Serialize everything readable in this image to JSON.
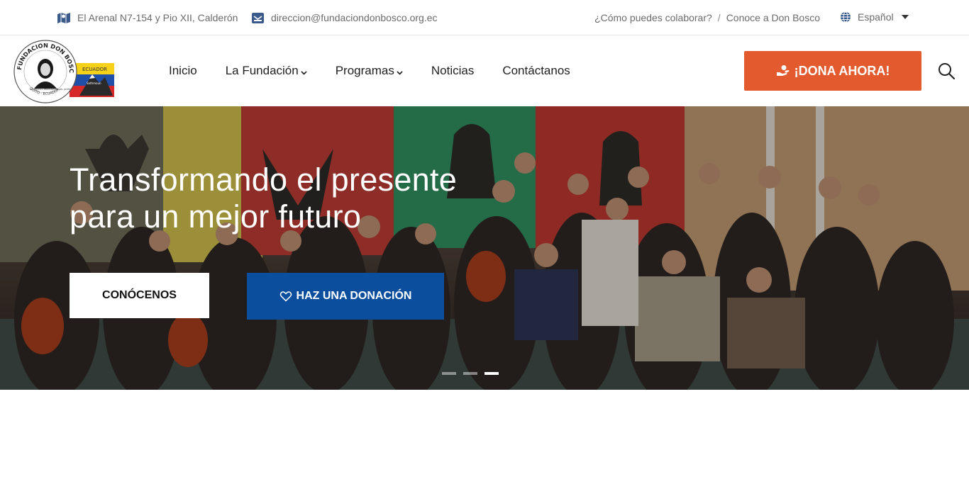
{
  "topbar": {
    "address": "El Arenal N7-154 y Pio XII, Calderón",
    "email": "direccion@fundaciondonbosco.org.ec",
    "link_collaborate": "¿Cómo puedes colaborar?",
    "separator": "/",
    "link_about": "Conoce a Don Bosco",
    "language": "Español",
    "icons": {
      "address": "map-icon",
      "email": "email-icon",
      "language": "globe-icon"
    }
  },
  "header": {
    "logo": {
      "ring_text": "FUNDACION DON BOSCO",
      "bottom_text": "QUITO - ECUADOR",
      "inner_text": "AL SERVICIO PERMANENTE DEL JOVEN",
      "flag_text": "ECUADOR",
      "flag_sub": "Sathmoun"
    },
    "nav": [
      {
        "label": "Inicio",
        "has_dropdown": false
      },
      {
        "label": "La Fundación",
        "has_dropdown": true
      },
      {
        "label": "Programas",
        "has_dropdown": true
      },
      {
        "label": "Noticias",
        "has_dropdown": false
      },
      {
        "label": "Contáctanos",
        "has_dropdown": false
      }
    ],
    "donate_label": "¡DONA AHORA!",
    "colors": {
      "donate": "#e35a2f",
      "text": "#1f1f1f"
    }
  },
  "hero": {
    "title_line1": "Transformando el presente",
    "title_line2": "para un mejor futuro",
    "btn_about": "CONÓCENOS",
    "btn_donate": "HAZ UNA DONACIÓN",
    "slides_count": 3,
    "active_slide": 3,
    "colors": {
      "donate_btn": "#0b4e9e"
    }
  }
}
